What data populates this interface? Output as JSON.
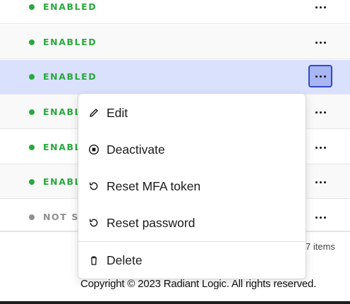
{
  "rows": [
    {
      "status": "ENABLED"
    },
    {
      "status": "ENABLED"
    },
    {
      "status": "ENABLED"
    },
    {
      "status": "ENABLED"
    },
    {
      "status": "ENABLED"
    },
    {
      "status": "ENABLED"
    },
    {
      "status": "NOT SE"
    }
  ],
  "status_colors": {
    "enabled": "#2aa83e",
    "not_set": "#8f8f8f",
    "selected_row": "#d9e1fd"
  },
  "context_menu": {
    "items": [
      {
        "label": "Edit",
        "icon": "pencil-icon"
      },
      {
        "label": "Deactivate",
        "icon": "stop-circle-icon"
      },
      {
        "label": "Reset MFA token",
        "icon": "reset-icon"
      },
      {
        "label": "Reset password",
        "icon": "reset-icon"
      },
      {
        "label": "Delete",
        "icon": "trash-icon"
      }
    ]
  },
  "pagination": {
    "items_text": "7 items"
  },
  "footer": {
    "copyright": "Copyright © 2023 Radiant Logic. All rights reserved."
  }
}
